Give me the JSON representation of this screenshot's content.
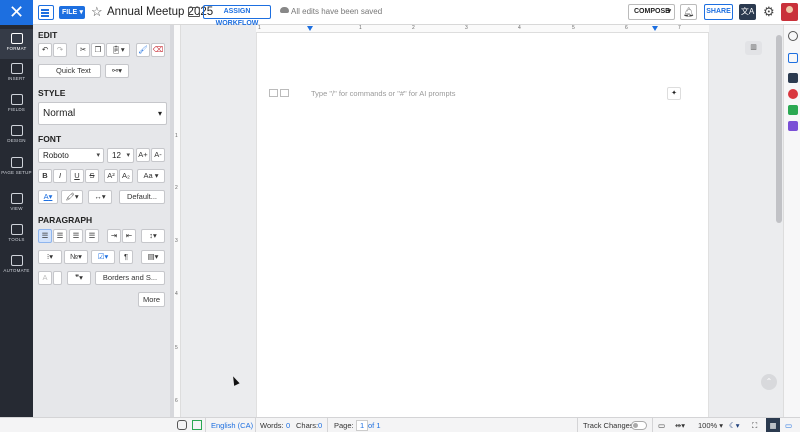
{
  "topbar": {
    "file_label": "FILE",
    "doc_title": "Annual Meetup 2025",
    "assign_workflow_label": "ASSIGN WORKFLOW",
    "save_status": "All edits have been saved",
    "compose_label": "COMPOSE",
    "share_label": "SHARE",
    "translate_glyph": "文A"
  },
  "rail": {
    "items": [
      {
        "label": "FORMAT"
      },
      {
        "label": "INSERT"
      },
      {
        "label": "FIELDS"
      },
      {
        "label": "DESIGN"
      },
      {
        "label": "PAGE SETUP"
      },
      {
        "label": "VIEW"
      },
      {
        "label": "TOOLS"
      },
      {
        "label": "AUTOMATE"
      }
    ]
  },
  "panel": {
    "edit_title": "EDIT",
    "quick_text_label": "Quick Text",
    "style_title": "STYLE",
    "style_value": "Normal",
    "font_title": "FONT",
    "font_family": "Roboto",
    "font_size": "12",
    "grow_label": "A+",
    "shrink_label": "A-",
    "bold": "B",
    "italic": "I",
    "underline": "U",
    "strike": "S",
    "superscript": "A²",
    "subscript": "A₂",
    "case_label": "Aa",
    "font_color_label": "A",
    "default_label": "Default...",
    "paragraph_title": "PARAGRAPH",
    "borders_label": "Borders and S...",
    "more_label": "More"
  },
  "ruler": {
    "h_numbers": [
      "1",
      "1",
      "2",
      "3",
      "4",
      "5",
      "6",
      "7"
    ],
    "v_numbers": [
      "1",
      "2",
      "3",
      "4",
      "5",
      "6"
    ]
  },
  "document": {
    "placeholder": "Type \"/\" for commands or \"#\" for AI prompts"
  },
  "statusbar": {
    "language": "English (CA)",
    "words_label": "Words:",
    "words_value": "0",
    "chars_label": "Chars:",
    "chars_value": "0",
    "page_label": "Page:",
    "page_current": "1",
    "page_total": "of 1",
    "track_changes_label": "Track Changes",
    "zoom": "100%"
  }
}
